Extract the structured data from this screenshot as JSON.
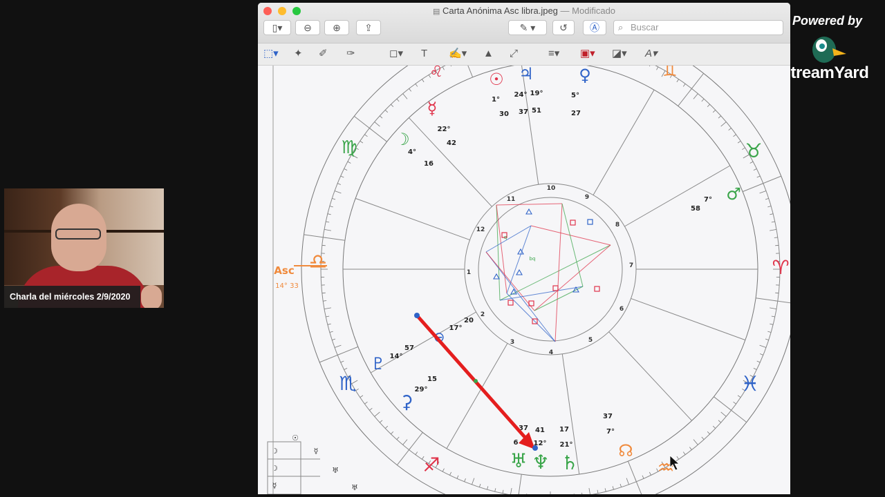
{
  "webcam": {
    "caption": "Charla del miércoles 2/9/2020"
  },
  "branding": {
    "powered_by": "Powered by",
    "name": "StreamYard"
  },
  "window": {
    "title": "Carta Anónima Asc libra.jpeg",
    "status": "— Modificado",
    "search_placeholder": "Buscar"
  },
  "chart": {
    "asc_label": "Asc",
    "asc_degree": "14° 33",
    "house_numbers": [
      "1",
      "2",
      "3",
      "4",
      "5",
      "6",
      "7",
      "8",
      "9",
      "10",
      "11",
      "12"
    ],
    "labels": [
      {
        "t": "1°"
      },
      {
        "t": "30"
      },
      {
        "t": "24°"
      },
      {
        "t": "19°"
      },
      {
        "t": "37"
      },
      {
        "t": "51"
      },
      {
        "t": "5°"
      },
      {
        "t": "27"
      },
      {
        "t": "22°"
      },
      {
        "t": "42"
      },
      {
        "t": "4°"
      },
      {
        "t": "16"
      },
      {
        "t": "58"
      },
      {
        "t": "7°"
      },
      {
        "t": "17°"
      },
      {
        "t": "20"
      },
      {
        "t": "14°"
      },
      {
        "t": "57"
      },
      {
        "t": "15"
      },
      {
        "t": "29°"
      },
      {
        "t": "37"
      },
      {
        "t": "41"
      },
      {
        "t": "17"
      },
      {
        "t": "6"
      },
      {
        "t": "12°"
      },
      {
        "t": "21°"
      },
      {
        "t": "37"
      },
      {
        "t": "7°"
      }
    ],
    "glyphs": [
      {
        "g": "♌︎",
        "c": "#e0334a"
      },
      {
        "g": "☉︎",
        "c": "#e0334a"
      },
      {
        "g": "♃︎",
        "c": "#2f63c8"
      },
      {
        "g": "♀︎",
        "c": "#2f63c8"
      },
      {
        "g": "♊︎",
        "c": "#f08a3c"
      },
      {
        "g": "☿︎",
        "c": "#e0334a"
      },
      {
        "g": "☽︎",
        "c": "#3aa54a"
      },
      {
        "g": "♍︎",
        "c": "#3aa54a"
      },
      {
        "g": "♉︎",
        "c": "#3aa54a"
      },
      {
        "g": "♂︎",
        "c": "#3aa54a"
      },
      {
        "g": "♎︎",
        "c": "#f08a3c"
      },
      {
        "g": "♈︎",
        "c": "#e0334a"
      },
      {
        "g": "♇︎",
        "c": "#2f63c8"
      },
      {
        "g": "♏︎",
        "c": "#2f63c8"
      },
      {
        "g": "⚳",
        "c": "#2f63c8"
      },
      {
        "g": "♓︎",
        "c": "#2f63c8"
      },
      {
        "g": "☊︎",
        "c": "#f08a3c"
      },
      {
        "g": "♐︎",
        "c": "#e0334a"
      },
      {
        "g": "♅︎",
        "c": "#3aa54a"
      },
      {
        "g": "♆︎",
        "c": "#3aa54a"
      },
      {
        "g": "♄︎",
        "c": "#3aa54a"
      },
      {
        "g": "♒︎",
        "c": "#f08a3c"
      },
      {
        "g": "⊖",
        "c": "#2f63c8"
      }
    ],
    "table_glyphs": [
      "☉︎",
      "☽︎",
      "☿︎",
      "☽︎",
      "♅︎",
      "☿︎",
      "♅︎"
    ],
    "aspect_labels": [
      "bq",
      "q"
    ]
  },
  "colors": {
    "red": "#e0334a",
    "blue": "#2f63c8",
    "green": "#3aa54a",
    "orange": "#f08a3c",
    "arrow": "#e41e1e"
  }
}
